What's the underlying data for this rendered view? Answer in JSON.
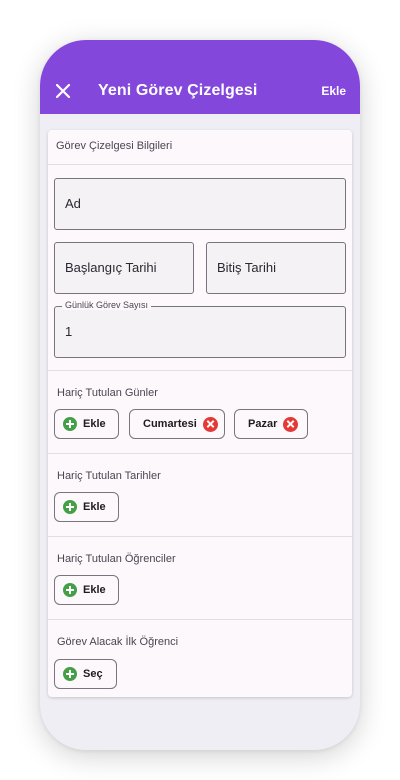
{
  "appbar": {
    "title": "Yeni Görev Çizelgesi",
    "action_label": "Ekle",
    "color": "#8347dc"
  },
  "card": {
    "header": "Görev Çizelgesi Bilgileri"
  },
  "form": {
    "name_placeholder": "Ad",
    "start_date_placeholder": "Başlangıç Tarihi",
    "end_date_placeholder": "Bitiş Tarihi",
    "daily_task_label": "Günlük Görev Sayısı",
    "daily_task_value": "1"
  },
  "excluded_days": {
    "title": "Hariç Tutulan Günler",
    "add_label": "Ekle",
    "chips": [
      "Cumartesi",
      "Pazar"
    ]
  },
  "excluded_dates": {
    "title": "Hariç Tutulan Tarihler",
    "add_label": "Ekle"
  },
  "excluded_students": {
    "title": "Hariç Tutulan Öğrenciler",
    "add_label": "Ekle"
  },
  "first_student": {
    "title": "Görev Alacak İlk Öğrenci",
    "select_label": "Seç"
  },
  "icons": {
    "close": "close-icon",
    "add": "add-circle-icon",
    "remove": "remove-circle-icon",
    "add_color": "#43a047",
    "remove_color": "#e53935"
  }
}
